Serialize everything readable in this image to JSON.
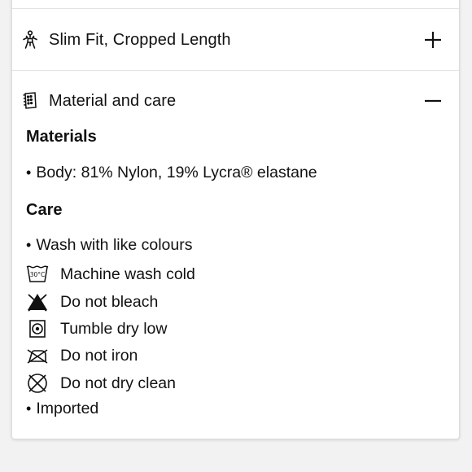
{
  "accordion": {
    "fit": {
      "label": "Slim Fit, Cropped Length",
      "icon": "person-icon",
      "toggle": "plus-icon"
    },
    "material": {
      "label": "Material and care",
      "icon": "fabric-tag-icon",
      "toggle": "minus-icon"
    }
  },
  "materials": {
    "heading": "Materials",
    "items": [
      "Body: 81% Nylon, 19% Lycra® elastane"
    ]
  },
  "care": {
    "heading": "Care",
    "intro": "Wash with like colours",
    "instructions": [
      {
        "label": "Machine wash cold",
        "icon": "wash-30c-icon",
        "wash_temp": "30°C"
      },
      {
        "label": "Do not bleach",
        "icon": "no-bleach-icon"
      },
      {
        "label": "Tumble dry low",
        "icon": "tumble-dry-low-icon"
      },
      {
        "label": "Do not iron",
        "icon": "no-iron-icon"
      },
      {
        "label": "Do not dry clean",
        "icon": "no-dry-clean-icon"
      }
    ],
    "footer": "Imported"
  },
  "bullet_char": "•"
}
